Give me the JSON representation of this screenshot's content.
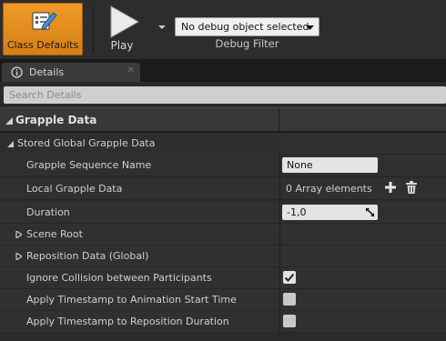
{
  "toolbar": {
    "class_defaults_label": "Class Defaults",
    "play_label": "Play",
    "debug_object_value": "No debug object selected",
    "debug_filter_label": "Debug Filter"
  },
  "tab": {
    "label": "Details"
  },
  "search": {
    "placeholder": "Search Details"
  },
  "category": {
    "label": "Grapple Data"
  },
  "properties": {
    "stored_group": "Stored Global Grapple Data",
    "sequence_name": {
      "label": "Grapple Sequence Name",
      "value": "None"
    },
    "local_data": {
      "label": "Local Grapple Data",
      "value": "0 Array elements"
    },
    "duration": {
      "label": "Duration",
      "value": "-1,0"
    },
    "scene_root": {
      "label": "Scene Root"
    },
    "reposition": {
      "label": "Reposition Data (Global)"
    },
    "ignore_collision": {
      "label": "Ignore Collision between Participants",
      "checked": true
    },
    "timestamp_anim": {
      "label": "Apply Timestamp to Animation Start Time",
      "checked": false
    },
    "timestamp_reposition": {
      "label": "Apply Timestamp to Reposition Duration",
      "checked": false
    }
  },
  "colors": {
    "accent": "#e88b1f",
    "panel": "#303030",
    "background": "#1e1e1e"
  }
}
